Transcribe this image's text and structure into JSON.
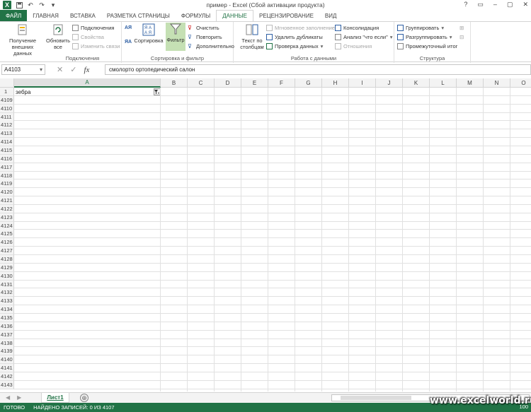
{
  "window": {
    "title": "пример - Excel (Сбой активации продукта)",
    "controls": [
      "?",
      "▭",
      "–",
      "▢",
      "✕"
    ]
  },
  "quick_access": {
    "icons": [
      "save-icon",
      "undo-icon",
      "redo-icon",
      "customize-icon"
    ]
  },
  "tabs": [
    {
      "label": "ФАЙЛ",
      "style": "file"
    },
    {
      "label": "ГЛАВНАЯ"
    },
    {
      "label": "ВСТАВКА"
    },
    {
      "label": "РАЗМЕТКА СТРАНИЦЫ"
    },
    {
      "label": "ФОРМУЛЫ"
    },
    {
      "label": "ДАННЫЕ",
      "active": true
    },
    {
      "label": "РЕЦЕНЗИРОВАНИЕ"
    },
    {
      "label": "ВИД"
    }
  ],
  "ribbon": {
    "connections_group": {
      "label": "Подключения",
      "external_data": "Получение внешних данных",
      "refresh_all": "Обновить все",
      "connections": "Подключения",
      "properties": "Свойства",
      "edit_links": "Изменить связи"
    },
    "sort_filter_group": {
      "label": "Сортировка и фильтр",
      "sort": "Сортировка",
      "filter": "Фильтр",
      "clear": "Очистить",
      "reapply": "Повторить",
      "advanced": "Дополнительно",
      "sort_az": "АЯ",
      "sort_za": "ЯА"
    },
    "data_tools_group": {
      "label": "Работа с данными",
      "text_to_columns": "Текст по столбцам",
      "flash_fill": "Мгновенное заполнение",
      "remove_duplicates": "Удалить дубликаты",
      "data_validation": "Проверка данных",
      "consolidate": "Консолидация",
      "what_if": "Анализ \"что если\"",
      "relationships": "Отношения"
    },
    "outline_group": {
      "label": "Структура",
      "group": "Группировать",
      "ungroup": "Разгруппировать",
      "subtotal": "Промежуточный итог"
    }
  },
  "formula_bar": {
    "name_box": "A4103",
    "formula": "смолорто ортопедический салон",
    "cancel": "✕",
    "enter": "✓",
    "fx": "fx"
  },
  "grid": {
    "columns": [
      "A",
      "B",
      "C",
      "D",
      "E",
      "F",
      "G",
      "H",
      "I",
      "J",
      "K",
      "L",
      "M",
      "N",
      "O"
    ],
    "header_row": {
      "row": "1",
      "a_value": "зебра"
    },
    "rows": [
      "4109",
      "4110",
      "4111",
      "4112",
      "4113",
      "4114",
      "4115",
      "4116",
      "4117",
      "4118",
      "4119",
      "4120",
      "4121",
      "4122",
      "4123",
      "4124",
      "4125",
      "4126",
      "4127",
      "4128",
      "4129",
      "4130",
      "4131",
      "4132",
      "4133",
      "4134",
      "4135",
      "4136",
      "4137",
      "4138",
      "4139",
      "4140",
      "4141",
      "4142",
      "4143"
    ]
  },
  "sheets": {
    "tabs": [
      "Лист1"
    ],
    "add": "⊕",
    "nav": [
      "◀",
      "▶"
    ]
  },
  "status": {
    "ready": "ГОТОВО",
    "found": "НАЙДЕНО ЗАПИСЕЙ: 0 ИЗ 4107",
    "zoom": "100"
  },
  "watermark": "www.excelworld.ru",
  "colors": {
    "accent": "#217346",
    "filter_active": "#c5e0b4"
  }
}
